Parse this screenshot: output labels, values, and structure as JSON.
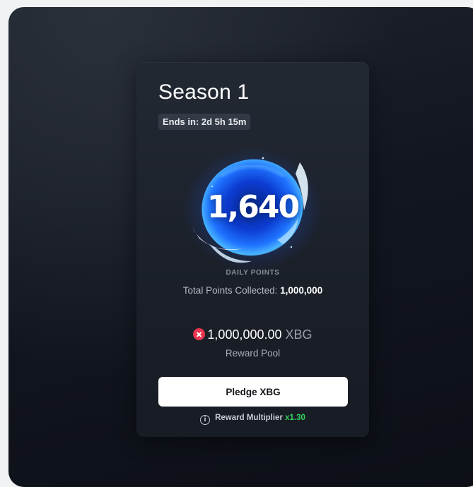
{
  "season": {
    "title": "Season 1",
    "ends_in": "Ends in: 2d 5h 15m"
  },
  "points": {
    "value": "1,640",
    "label": "DAILY POINTS",
    "total_label": "Total Points Collected:",
    "total_value": "1,000,000"
  },
  "pool": {
    "icon": "x-circle-icon",
    "amount": "1,000,000.00",
    "unit": "XBG",
    "label": "Reward Pool"
  },
  "pledge": {
    "button_label": "Pledge XBG"
  },
  "multiplier": {
    "icon": "info-icon",
    "icon_glyph": "i",
    "label": "Reward Multiplier",
    "value": "x1.30"
  },
  "colors": {
    "accent_green": "#2fd35b",
    "accent_red": "#e8354f",
    "orb_blue": "#1a73ff"
  }
}
